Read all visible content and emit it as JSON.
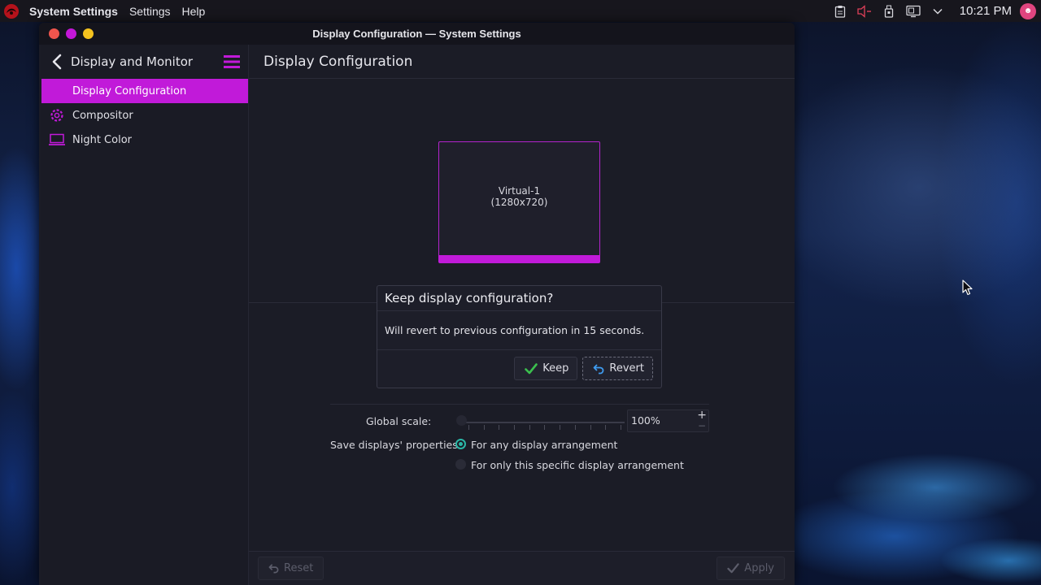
{
  "top_panel": {
    "app_logo_icon": "app-logo-icon",
    "menus": [
      "System Settings",
      "Settings",
      "Help"
    ],
    "tray_icons": [
      "clipboard-icon",
      "volume-muted-icon",
      "usb-drive-icon",
      "network-icon",
      "chevron-down-icon"
    ],
    "clock": "10:21 PM",
    "avatar_icon": "user-avatar-icon"
  },
  "window": {
    "title": "Display Configuration — System Settings",
    "controls": [
      "close",
      "minimize",
      "maximize"
    ]
  },
  "sidebar": {
    "title": "Display and Monitor",
    "items": [
      {
        "label": "Display Configuration",
        "icon": "display-icon",
        "active": true
      },
      {
        "label": "Compositor",
        "icon": "gear-icon",
        "active": false
      },
      {
        "label": "Night Color",
        "icon": "laptop-icon",
        "active": false
      }
    ]
  },
  "main": {
    "title": "Display Configuration",
    "monitor": {
      "name": "Virtual-1",
      "resolution": "(1280x720)"
    },
    "dialog": {
      "title": "Keep display configuration?",
      "message": "Will revert to previous configuration in 15 seconds.",
      "keep_label": "Keep",
      "revert_label": "Revert"
    },
    "global_scale": {
      "label": "Global scale:",
      "value": "100%",
      "level": 0.0
    },
    "save_props": {
      "label": "Save displays' properties:",
      "options": [
        {
          "label": "For any display arrangement",
          "selected": true
        },
        {
          "label": "For only this specific display arrangement",
          "selected": false
        }
      ]
    },
    "footer": {
      "reset_label": "Reset",
      "apply_label": "Apply"
    }
  },
  "colors": {
    "accent": "#c11ad9",
    "radio_on": "#2bb6a6",
    "close": "#f0554d",
    "minimize": "#c317d8",
    "maximize": "#f4c21f"
  }
}
